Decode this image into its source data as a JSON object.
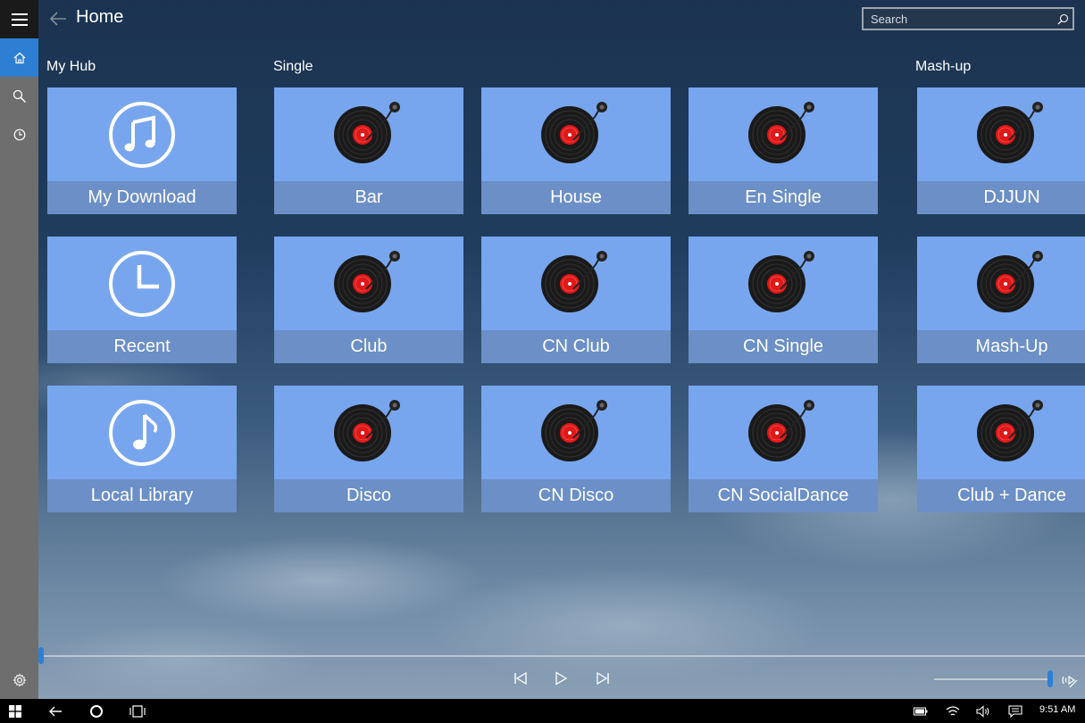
{
  "header": {
    "title": "Home",
    "search_placeholder": "Search"
  },
  "sections": {
    "my_hub": "My Hub",
    "single": "Single",
    "mashup": "Mash-up"
  },
  "tiles": {
    "my_download": "My Download",
    "recent": "Recent",
    "local_library": "Local Library",
    "bar": "Bar",
    "house": "House",
    "en_single": "En Single",
    "club": "Club",
    "cn_club": "CN Club",
    "cn_single": "CN Single",
    "disco": "Disco",
    "cn_disco": "CN Disco",
    "cn_socialdance": "CN SocialDance",
    "djjun": "DJJUN",
    "mash_up": "Mash-Up",
    "club_dance": "Club + Dance"
  },
  "player": {
    "progress": 0.0,
    "volume": 1.0
  },
  "taskbar": {
    "clock": "9:51 AM"
  },
  "colors": {
    "accent": "#2d7fd3",
    "tile": "#78a6ee",
    "tile_label": "#6b8fc6",
    "rail": "#6e6e6e"
  }
}
